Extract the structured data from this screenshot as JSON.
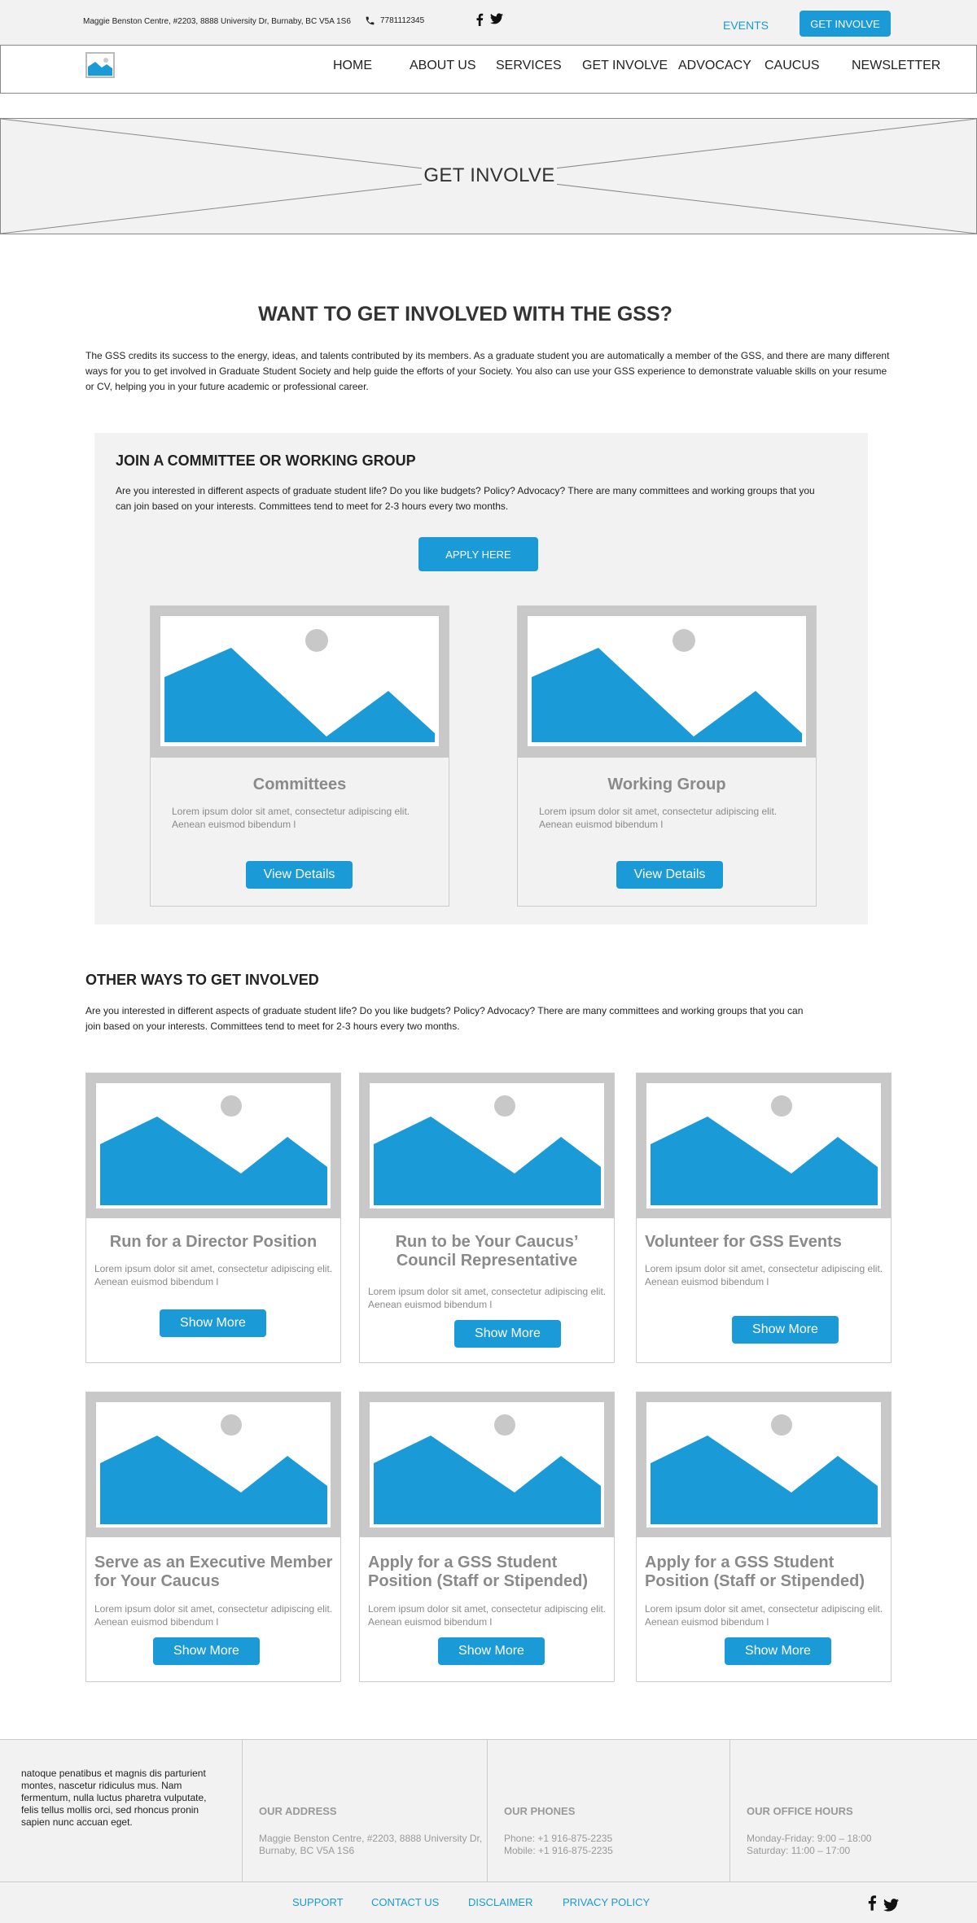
{
  "topbar": {
    "address": "Maggie Benston Centre, #2203, 8888 University Dr, Burnaby, BC V5A 1S6",
    "phone": "7781112345",
    "events_label": "EVENTS",
    "cta_label": "GET INVOLVE"
  },
  "nav": {
    "items": [
      "HOME",
      "ABOUT US",
      "SERVICES",
      "GET INVOLVE",
      "ADVOCACY",
      "CAUCUS",
      "NEWSLETTER"
    ]
  },
  "hero": {
    "title": "GET INVOLVE"
  },
  "main": {
    "heading": "WANT TO GET INVOLVED WITH THE GSS?",
    "intro": "The GSS credits its success to the energy, ideas, and talents contributed by its members. As a graduate student you are automatically a member of the GSS, and there are many different ways for you to get involved in Graduate Student Society and help guide the efforts of your Society. You also can use your GSS experience to demonstrate valuable skills on your resume or CV, helping you in your future academic or professional career."
  },
  "committee": {
    "heading": "JOIN A COMMITTEE OR WORKING GROUP",
    "text": "Are you interested in different aspects of graduate student life? Do you like budgets? Policy? Advocacy? There are many committees and working groups that you can join based on your interests. Committees tend to meet for 2-3 hours every two months.",
    "apply_label": "APPLY HERE",
    "cards": [
      {
        "title": "Committees",
        "desc": "Lorem ipsum dolor sit amet, consectetur adipiscing elit. Aenean euismod bibendum l",
        "button": "View Details"
      },
      {
        "title": "Working Group",
        "desc": "Lorem ipsum dolor sit amet, consectetur adipiscing elit. Aenean euismod bibendum l",
        "button": "View Details"
      }
    ]
  },
  "other": {
    "heading": "OTHER WAYS TO GET INVOLVED",
    "text": "Are you interested in different aspects of graduate student life? Do you like budgets? Policy? Advocacy? There are many committees and working groups that you can join based on your interests. Committees tend to meet for 2-3 hours every two months.",
    "cards": [
      {
        "title": "Run for a Director Position",
        "desc": "Lorem ipsum dolor sit amet, consectetur adipiscing elit. Aenean euismod bibendum l",
        "button": "Show More"
      },
      {
        "title": "Run to be Your Caucus’ Council Representative",
        "desc": "Lorem ipsum dolor sit amet, consectetur adipiscing elit. Aenean euismod bibendum l",
        "button": "Show More"
      },
      {
        "title": "Volunteer for GSS Events",
        "desc": "Lorem ipsum dolor sit amet, consectetur adipiscing elit. Aenean euismod bibendum l",
        "button": "Show More"
      },
      {
        "title": "Serve as an Executive Member for Your Caucus",
        "desc": "Lorem ipsum dolor sit amet, consectetur adipiscing elit. Aenean euismod bibendum l",
        "button": "Show More"
      },
      {
        "title": "Apply for a GSS Student Position (Staff or Stipended)",
        "desc": "Lorem ipsum dolor sit amet, consectetur adipiscing elit. Aenean euismod bibendum l",
        "button": "Show More"
      },
      {
        "title": "Apply for a GSS Student Position (Staff or Stipended)",
        "desc": "Lorem ipsum dolor sit amet, consectetur adipiscing elit. Aenean euismod bibendum l",
        "button": "Show More"
      }
    ]
  },
  "footer": {
    "blurb": "natoque penatibus et magnis dis parturient montes, nascetur ridiculus mus. Nam fermentum, nulla luctus pharetra vulputate, felis tellus mollis orci, sed rhoncus pronin sapien nunc accuan eget.",
    "address_heading": "OUR ADDRESS",
    "address": "Maggie Benston Centre, #2203, 8888 University Dr, Burnaby, BC V5A 1S6",
    "phones_heading": "OUR PHONES",
    "phone1": "Phone: +1 916-875-2235",
    "phone2": "Mobile: +1 916-875-2235",
    "hours_heading": "OUR OFFICE HOURS",
    "hours1": "Monday-Friday: 9:00 – 18:00",
    "hours2": "Saturday: 11:00 – 17:00",
    "links": [
      "SUPPORT",
      "CONTACT US",
      "DISCLAIMER",
      "PRIVACY POLICY"
    ]
  },
  "icons": {
    "phone": "phone-icon",
    "facebook": "facebook-icon",
    "twitter": "twitter-icon",
    "placeholder": "image-placeholder-icon"
  },
  "colors": {
    "accent": "#1a9ad6",
    "panel": "#f2f2f2"
  }
}
